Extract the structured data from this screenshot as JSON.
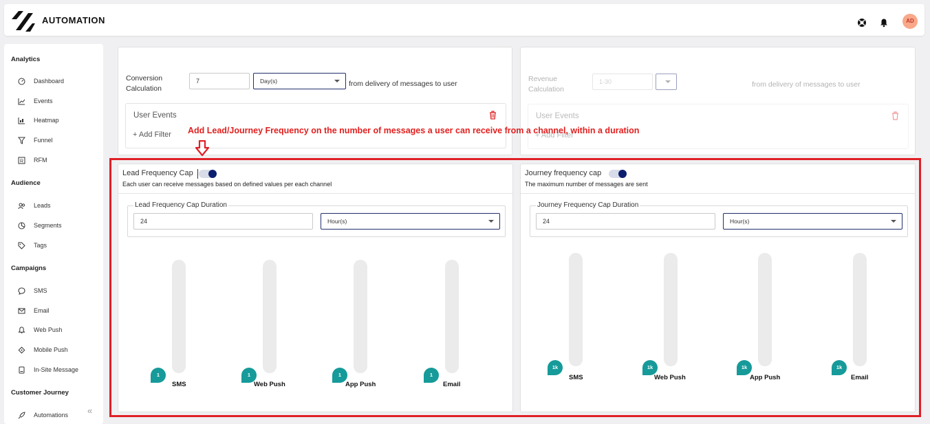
{
  "header": {
    "app_title": "AUTOMATION",
    "avatar_initials": "AD"
  },
  "sidebar": {
    "sections": [
      {
        "title": "Analytics",
        "items": [
          "Dashboard",
          "Events",
          "Heatmap",
          "Funnel",
          "RFM"
        ]
      },
      {
        "title": "Audience",
        "items": [
          "Leads",
          "Segments",
          "Tags"
        ]
      },
      {
        "title": "Campaigns",
        "items": [
          "SMS",
          "Email",
          "Web Push",
          "Mobile Push",
          "In-Site Message"
        ]
      },
      {
        "title": "Customer Journey",
        "items": [
          "Automations"
        ]
      }
    ]
  },
  "conversion": {
    "label_line1": "Conversion",
    "label_line2": "Calculation",
    "value": "7",
    "unit": "Day(s)",
    "suffix": "from delivery of messages to user",
    "user_events": "User Events",
    "add_filter": "+ Add Filter"
  },
  "revenue": {
    "label_line1": "Revenue",
    "label_line2": "Calculation",
    "placeholder": "1-30",
    "suffix": "from delivery of messages to user",
    "user_events": "User Events",
    "add_filter": "+ Add Filter"
  },
  "annotation": "Add Lead/Journey Frequency on the number of messages a user can receive from a channel, within a duration",
  "lead_cap": {
    "title": "Lead Frequency Cap",
    "description": "Each user can receive messages based on defined values per each channel",
    "enabled": true,
    "duration_legend": "Lead Frequency Cap Duration",
    "duration_value": "24",
    "duration_unit": "Hour(s)",
    "channels": [
      {
        "label": "SMS",
        "value": "1"
      },
      {
        "label": "Web Push",
        "value": "1"
      },
      {
        "label": "App Push",
        "value": "1"
      },
      {
        "label": "Email",
        "value": "1"
      }
    ]
  },
  "journey_cap": {
    "title": "Journey frequency cap",
    "description": "The maximum number of messages are sent",
    "enabled": true,
    "duration_legend": "Journey Frequency Cap Duration",
    "duration_value": "24",
    "duration_unit": "Hour(s)",
    "channels": [
      {
        "label": "SMS",
        "value": "1k"
      },
      {
        "label": "Web Push",
        "value": "1k"
      },
      {
        "label": "App Push",
        "value": "1k"
      },
      {
        "label": "Email",
        "value": "1k"
      }
    ]
  },
  "colors": {
    "accent": "#0c1e6e",
    "annotation": "#e01f26",
    "slider_bubble": "#169a9a",
    "avatar": "#f9a88a"
  }
}
